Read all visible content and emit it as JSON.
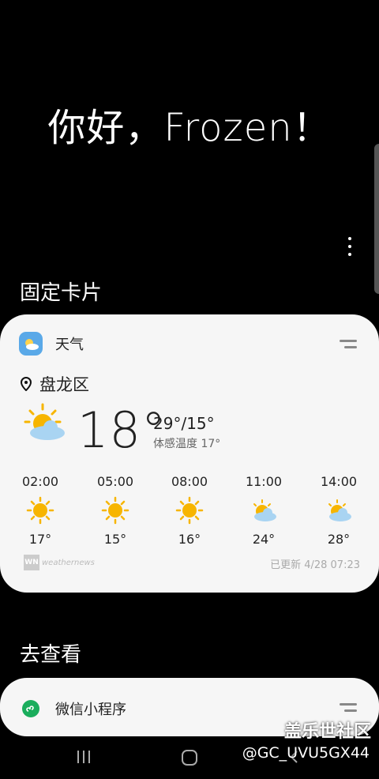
{
  "greeting": "你好，Frozen！",
  "sections": {
    "pinned_title": "固定卡片",
    "explore_title": "去查看"
  },
  "weather": {
    "card_title": "天气",
    "location": "盘龙区",
    "current_temp": "18°",
    "high_low": "29°/15°",
    "feels_like": "体感温度 17°",
    "hourly": [
      {
        "time": "02:00",
        "icon": "sunny-icon",
        "temp": "17°"
      },
      {
        "time": "05:00",
        "icon": "sunny-icon",
        "temp": "15°"
      },
      {
        "time": "08:00",
        "icon": "sunny-icon",
        "temp": "16°"
      },
      {
        "time": "11:00",
        "icon": "partly-cloudy-icon",
        "temp": "24°"
      },
      {
        "time": "14:00",
        "icon": "partly-cloudy-icon",
        "temp": "28°"
      }
    ],
    "provider_logo": "WN",
    "provider": "weathernews",
    "updated": "已更新 4/28 07:23"
  },
  "mini_program": {
    "label": "微信小程序"
  },
  "watermark": {
    "site": "盖乐世社区",
    "user": "@GC_UVU5GX44"
  },
  "colors": {
    "background": "#000000",
    "card": "#f6f6f6",
    "sun": "#f7b500",
    "cloud": "#a9d4f2",
    "wechat_green": "#1aad5c"
  }
}
